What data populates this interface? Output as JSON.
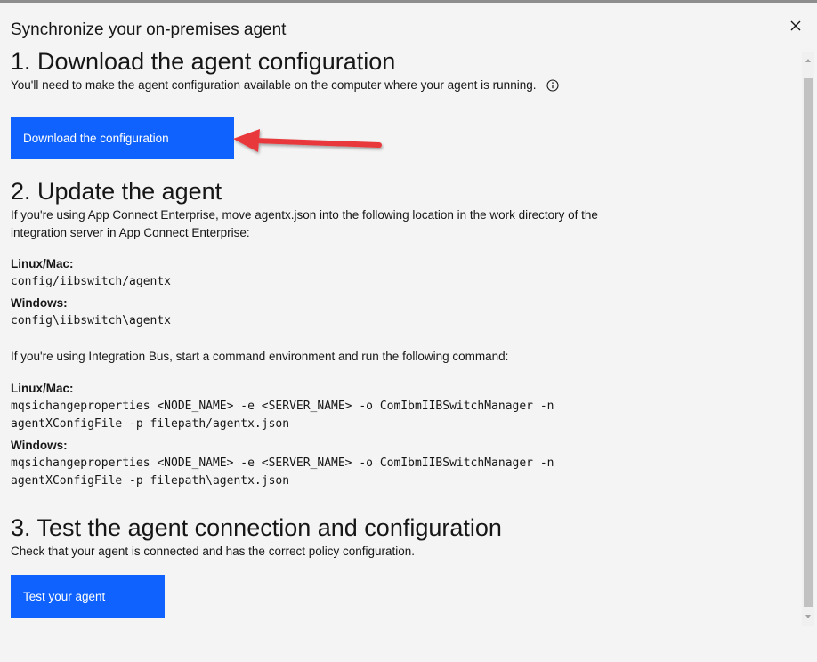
{
  "dialog": {
    "title": "Synchronize your on-premises agent"
  },
  "step1": {
    "heading": "1. Download the agent configuration",
    "description": "You'll need to make the agent configuration available on the computer where your agent is running.",
    "button_label": "Download the configuration"
  },
  "step2": {
    "heading": "2. Update the agent",
    "ace_description": "If you're using App Connect Enterprise, move agentx.json into the following location in the work directory of the integration server in App Connect Enterprise:",
    "ace_linux_label": "Linux/Mac:",
    "ace_linux_path": "config/iibswitch/agentx",
    "ace_windows_label": "Windows:",
    "ace_windows_path": "config\\iibswitch\\agentx",
    "iib_description": "If you're using Integration Bus, start a command environment and run the following command:",
    "iib_linux_label": "Linux/Mac:",
    "iib_linux_command": "mqsichangeproperties <NODE_NAME> -e <SERVER_NAME> -o ComIbmIIBSwitchManager -n agentXConfigFile -p filepath/agentx.json",
    "iib_windows_label": "Windows:",
    "iib_windows_command": "mqsichangeproperties <NODE_NAME> -e <SERVER_NAME> -o ComIbmIIBSwitchManager -n agentXConfigFile -p filepath\\agentx.json"
  },
  "step3": {
    "heading": "3. Test the agent connection and configuration",
    "description": "Check that your agent is connected and has the correct policy configuration.",
    "button_label": "Test your agent"
  },
  "icons": {
    "close": "close-icon",
    "info": "information-icon",
    "annotation_arrow": "red-arrow-icon"
  },
  "colors": {
    "primary_button": "#0f62fe",
    "annotation_arrow": "#e8393b"
  }
}
